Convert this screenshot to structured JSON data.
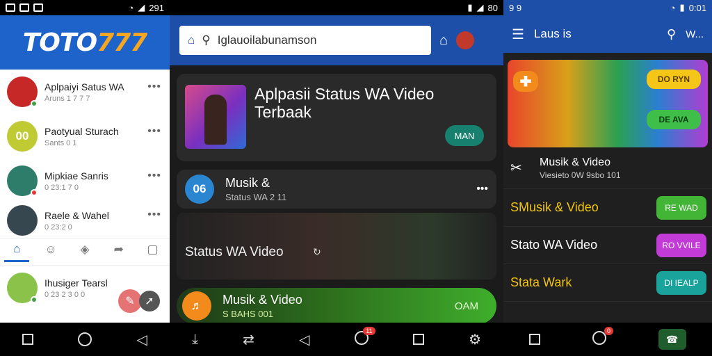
{
  "screen1": {
    "status": {
      "time": "291"
    },
    "logo": {
      "text": "TOTO",
      "number": "777"
    },
    "chats": [
      {
        "name": "Aplpaiyi Satus WA",
        "sub": "Aruns 1 7 7 7",
        "avatar_color": "#c62828",
        "dot_color": "#43a047"
      },
      {
        "name": "Paotyual Sturach",
        "sub": "Sants 0 1",
        "avatar_text": "00",
        "avatar_color": "#c0ca33",
        "dot_color": ""
      },
      {
        "name": "Mipkiae Sanris",
        "sub": "0 23:1 7 0",
        "avatar_color": "#2e7d6a",
        "dot_color": "#e53935"
      },
      {
        "name": "Raele & Wahel",
        "sub": "0 23:2 0",
        "avatar_color": "#37474f",
        "dot_color": ""
      },
      {
        "name": "Ihusiger Tearsl",
        "sub": "0 23 2 3 0 0",
        "avatar_color": "#8bc34a",
        "dot_color": "#43a047"
      }
    ],
    "more_label": "•••",
    "tabs": [
      "home-icon",
      "contacts-icon",
      "shield-icon",
      "share-icon",
      "square-icon"
    ]
  },
  "screen2": {
    "status": {
      "time": "80"
    },
    "search": {
      "value": "Iglauoilabunamson"
    },
    "hero": {
      "title": "Aplpasii Status WA Video Terbaak",
      "button": "MAN"
    },
    "item1": {
      "badge": "06",
      "title": "Musik &",
      "sub": "Status WA 2 11",
      "more": "•••"
    },
    "section_label": "Status WA Video",
    "item2": {
      "title": "Musik & Video",
      "sub": "S BAHS 001",
      "button": "OAM"
    },
    "nav_badge": "11"
  },
  "screen3": {
    "status": {
      "time": "0:01",
      "left": "9 9"
    },
    "appbar": {
      "title": "Laus is",
      "action": "W..."
    },
    "banner": {
      "btn_top": "DO RYN",
      "btn_bottom": "DE AVA"
    },
    "featured": {
      "title": "Musik & Video",
      "sub": "Viesieto 0W 9sbo 101"
    },
    "rows": [
      {
        "label": "SMusik & Video",
        "label_color": "#f1c40f",
        "button": "RE WAD",
        "button_color": "#43b536"
      },
      {
        "label": "Stato WA Video",
        "label_color": "#ffffff",
        "button": "RO VVILE",
        "button_color": "#c23bd6"
      },
      {
        "label": "Stata Wark",
        "label_color": "#f1c40f",
        "button": "DI IEALP",
        "button_color": "#1aa39b"
      }
    ],
    "nav_badge": "0"
  }
}
